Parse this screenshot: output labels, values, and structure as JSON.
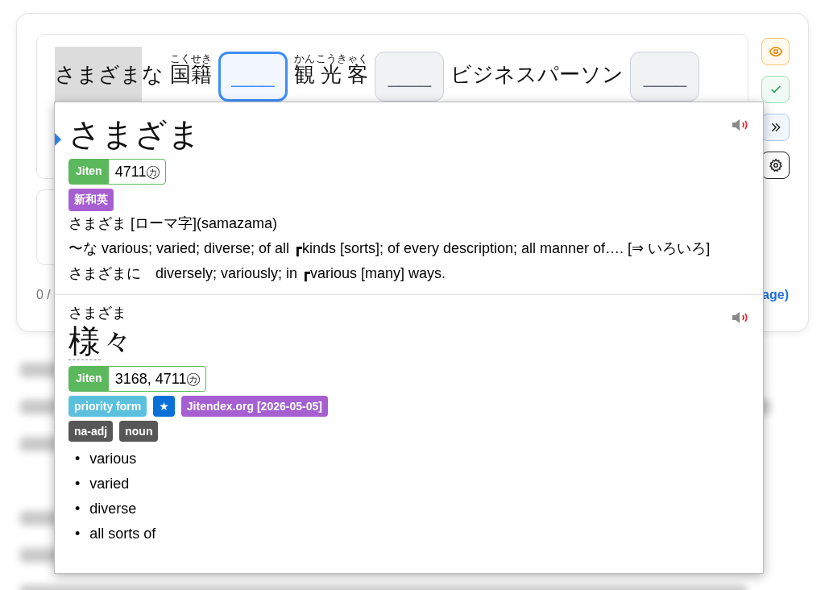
{
  "sentence": {
    "segments": [
      {
        "kind": "text",
        "text": "さまざま",
        "highlighted": true
      },
      {
        "kind": "text",
        "text": "な",
        "highlighted": false
      },
      {
        "kind": "ruby",
        "text": "国籍",
        "reading": "こくせき"
      },
      {
        "kind": "blank",
        "text": "____",
        "selected": true
      },
      {
        "kind": "ruby",
        "text": "観 光 客",
        "reading": "かんこうきゃく"
      },
      {
        "kind": "blank",
        "text": "____",
        "selected": false
      },
      {
        "kind": "text",
        "text": "ビジネスパーソン",
        "highlighted": false
      },
      {
        "kind": "blank",
        "text": "____",
        "selected": false
      }
    ]
  },
  "side_buttons": [
    {
      "kind": "eye"
    },
    {
      "kind": "check"
    },
    {
      "kind": "skip"
    },
    {
      "kind": "settings"
    }
  ],
  "progress_text": "0 /",
  "link_text": "age)",
  "popup": {
    "entries": [
      {
        "headword": "さまざま",
        "pointer": true,
        "frequency": {
          "source": "Jiten",
          "value": "4711㋕"
        },
        "tag_rows": [
          [
            {
              "text": "新和英",
              "color": "#a65fd0"
            }
          ]
        ],
        "definitions": [
          "さまざま [ローマ字](samazama)",
          "〜な various; varied; diverse; of all ┏kinds [sorts]; of every description; all manner of…. [⇒ いろいろ]",
          "さまざまに　diversely; variously; in ┏various [many] ways."
        ]
      },
      {
        "headword": "様々",
        "reading": "さまざま",
        "pointer": false,
        "frequency": {
          "source": "Jiten",
          "value": "3168, 4711㋕"
        },
        "tag_rows": [
          [
            {
              "text": "priority form",
              "color": "#5bc0de"
            },
            {
              "text": "★",
              "color": "#0b6fd8"
            },
            {
              "text": "Jitendex.org [2026-05-05]",
              "color": "#a65fd0"
            }
          ],
          [
            {
              "text": "na-adj",
              "color": "#575757"
            },
            {
              "text": "noun",
              "color": "#575757"
            }
          ]
        ],
        "glosses": [
          {
            "bullet": "•",
            "text": "various"
          },
          {
            "bullet": "•",
            "text": "varied"
          },
          {
            "bullet": "•",
            "text": "diverse"
          },
          {
            "bullet": "•",
            "text": "all sorts of"
          }
        ]
      }
    ]
  }
}
